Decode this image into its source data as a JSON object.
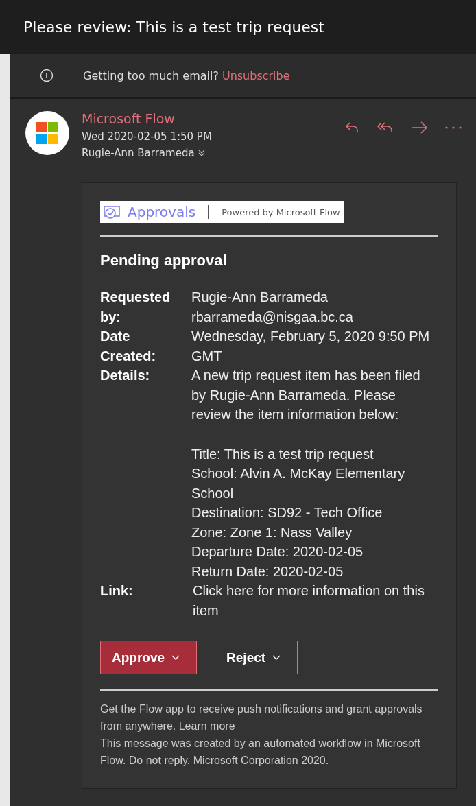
{
  "window": {
    "title": "Please review: This is a test trip request"
  },
  "notice": {
    "text": "Getting too much email?",
    "link": "Unsubscribe"
  },
  "message": {
    "sender": "Microsoft Flow",
    "date": "Wed 2020-02-05 1:50 PM",
    "recipient": "Rugie-Ann Barrameda"
  },
  "card": {
    "brand": "Approvals",
    "powered_by": "Powered by Microsoft Flow",
    "heading": "Pending approval",
    "fields": [
      {
        "kind": "text",
        "label": "Requested by:",
        "text": "Rugie-Ann Barrameda rbarrameda@nisgaa.bc.ca"
      },
      {
        "kind": "text",
        "label": "Date Created:",
        "text": "Wednesday, February 5, 2020 9:50 PM GMT"
      },
      {
        "kind": "list",
        "label": "Details:",
        "text": "A new trip request item has been filed by Rugie-Ann Barrameda. Please review the item information below:",
        "items": [
          "Title: This is a test trip request",
          "School: Alvin A. McKay Elementary School",
          "Destination: SD92 - Tech Office",
          "Zone: Zone 1: Nass Valley",
          "Departure Date: 2020-02-05",
          "Return Date: 2020-02-05"
        ]
      },
      {
        "kind": "link",
        "label": "Link:",
        "text": "Click here for more information on this item"
      }
    ],
    "buttons": [
      {
        "label": "Approve",
        "primary": true
      },
      {
        "label": "Reject",
        "primary": false
      }
    ],
    "footer": [
      "Get the Flow app to receive push notifications and grant approvals from anywhere. Learn more",
      "This message was created by an automated workflow in Microsoft Flow. Do not reply. Microsoft Corporation 2020."
    ]
  }
}
